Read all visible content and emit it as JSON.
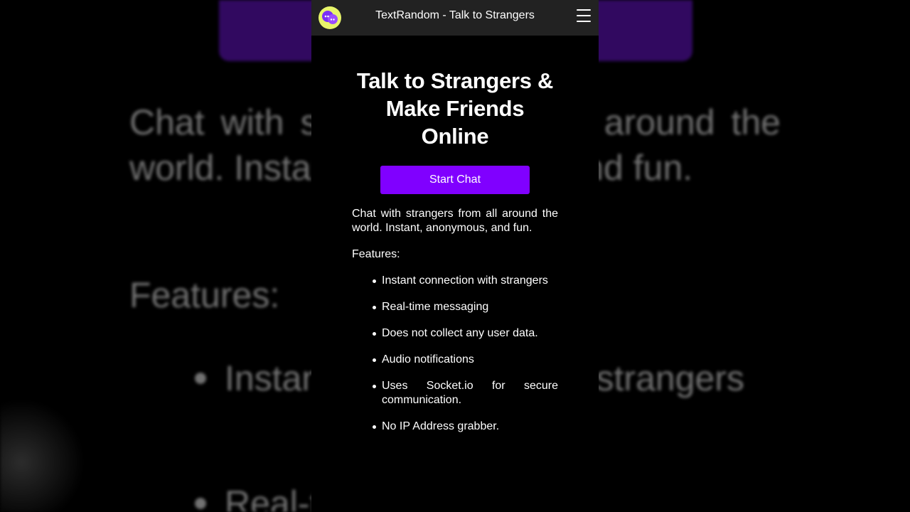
{
  "header": {
    "app_title": "TextRandom - Talk to Strangers",
    "logo_icon": "chat-bubbles-icon",
    "menu_icon": "hamburger-menu-icon"
  },
  "hero": {
    "title": "Talk to Strangers & Make Friends Online",
    "start_button_label": "Start Chat"
  },
  "description": "Chat with strangers from all around the world. Instant, anonymous, and fun.",
  "features": {
    "label": "Features:",
    "items": [
      "Instant connection with strangers",
      "Real-time messaging",
      "Does not collect any user data.",
      "Audio notifications",
      "Uses Socket.io for secure communication.",
      "No IP Address grabber."
    ]
  },
  "backdrop": {
    "para": "Chat with strangers from all around the world. Instant, anonymous, and fun.",
    "features_label": "Features:",
    "item1": "Instant connection with strangers",
    "item2": "Real-time messaging"
  },
  "colors": {
    "accent": "#8000ff",
    "header_bg": "#222222",
    "logo_bg": "#e8f56a",
    "page_bg": "#000000"
  }
}
